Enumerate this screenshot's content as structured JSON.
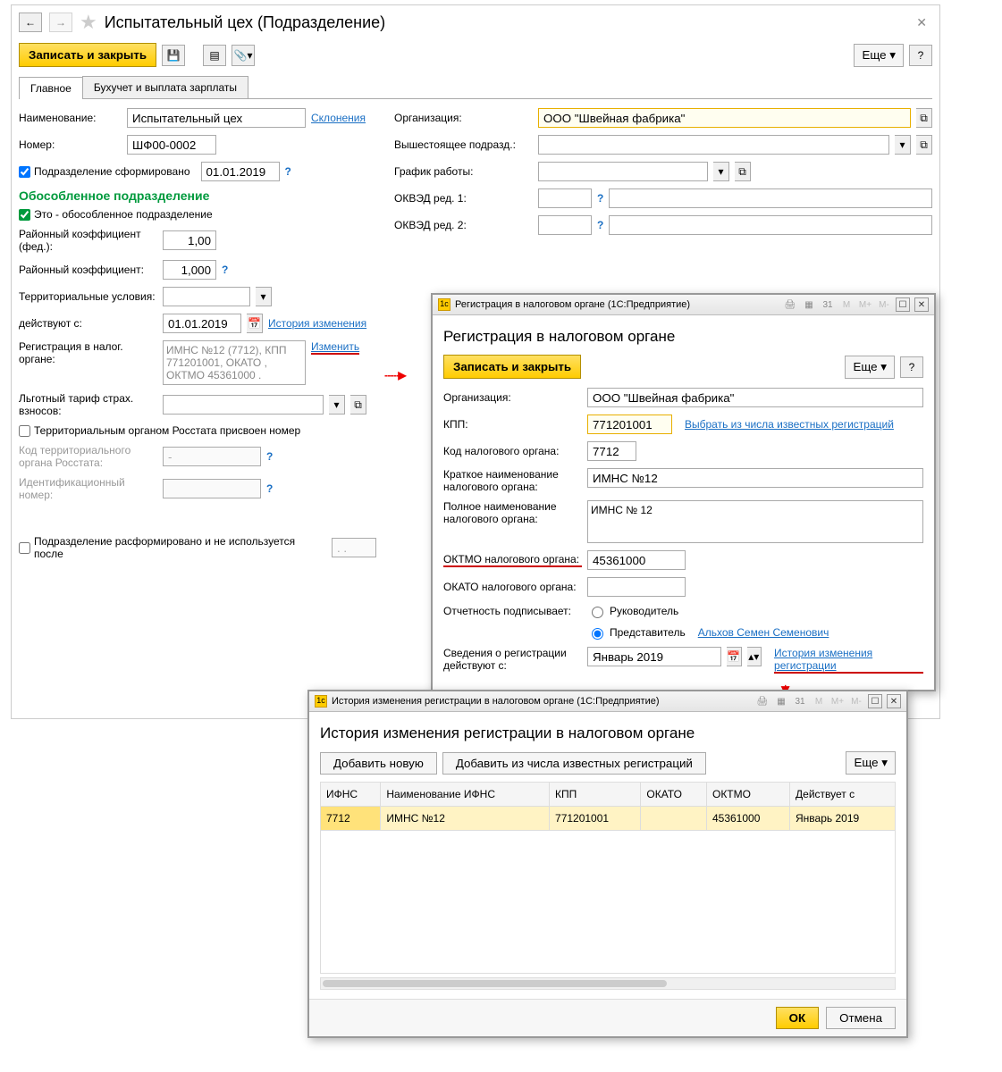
{
  "main": {
    "title": "Испытательный цех (Подразделение)",
    "toolbar": {
      "save_close": "Записать и закрыть",
      "more": "Еще"
    },
    "tabs": {
      "main": "Главное",
      "accounting": "Бухучет и выплата зарплаты"
    },
    "left": {
      "name_lbl": "Наименование:",
      "name_val": "Испытательный цех",
      "declension": "Склонения",
      "number_lbl": "Номер:",
      "number_val": "ШФ00-0002",
      "formed_chk": "Подразделение сформировано",
      "formed_date": "01.01.2019",
      "section": "Обособленное подразделение",
      "separate_chk": "Это - обособленное подразделение",
      "region_fed_lbl": "Районный коэффициент (фед.):",
      "region_fed_val": "1,00",
      "region_lbl": "Районный коэффициент:",
      "region_val": "1,000",
      "terr_lbl": "Территориальные условия:",
      "valid_lbl": "действуют с:",
      "valid_date": "01.01.2019",
      "history": "История изменения",
      "reg_lbl": "Регистрация в налог. органе:",
      "reg_val": "ИМНС №12 (7712), КПП 771201001, ОКАТО , ОКТМО 45361000 .",
      "change": "Изменить",
      "tariff_lbl": "Льготный тариф страх. взносов:",
      "rosstat_chk": "Территориальным органом Росстата присвоен номер",
      "code_lbl": "Код территориального органа Росстата:",
      "code_val": "-",
      "id_lbl": "Идентификационный номер:",
      "disband_chk": "Подразделение расформировано и не используется после",
      "disband_val": ". ."
    },
    "right": {
      "org_lbl": "Организация:",
      "org_val": "ООО \"Швейная фабрика\"",
      "parent_lbl": "Вышестоящее подразд.:",
      "schedule_lbl": "График работы:",
      "okved1_lbl": "ОКВЭД ред. 1:",
      "okved2_lbl": "ОКВЭД ред. 2:"
    }
  },
  "pop1": {
    "titlebar": "Регистрация в налоговом органе  (1С:Предприятие)",
    "h1": "Регистрация в налоговом органе",
    "save_close": "Записать и закрыть",
    "more": "Еще",
    "org_lbl": "Организация:",
    "org_val": "ООО \"Швейная фабрика\"",
    "kpp_lbl": "КПП:",
    "kpp_val": "771201001",
    "select_known": "Выбрать из числа известных регистраций",
    "code_lbl": "Код налогового органа:",
    "code_val": "7712",
    "short_lbl": "Краткое наименование налогового органа:",
    "short_val": "ИМНС №12",
    "full_lbl": "Полное наименование налогового органа:",
    "full_val": "ИМНС № 12",
    "oktmo_lbl": "ОКТМО налогового органа:",
    "oktmo_val": "45361000",
    "okato_lbl": "ОКАТО налогового органа:",
    "sign_lbl": "Отчетность подписывает:",
    "radio1": "Руководитель",
    "radio2": "Представитель",
    "rep_link": "Альхов Семен Семенович",
    "validfrom_lbl": "Сведения о регистрации действуют с:",
    "validfrom_val": "Январь 2019",
    "history_link": "История изменения регистрации"
  },
  "pop2": {
    "titlebar": "История изменения регистрации в налоговом органе  (1С:Предприятие)",
    "h1": "История изменения регистрации в налоговом органе",
    "add_new": "Добавить новую",
    "add_known": "Добавить из числа известных регистраций",
    "more": "Еще",
    "cols": {
      "ifns": "ИФНС",
      "name": "Наименование ИФНС",
      "kpp": "КПП",
      "okato": "ОКАТО",
      "oktmo": "ОКТМО",
      "from": "Действует с"
    },
    "row": {
      "ifns": "7712",
      "name": "ИМНС №12",
      "kpp": "771201001",
      "okato": "",
      "oktmo": "45361000",
      "from": "Январь 2019"
    },
    "ok": "ОК",
    "cancel": "Отмена"
  }
}
